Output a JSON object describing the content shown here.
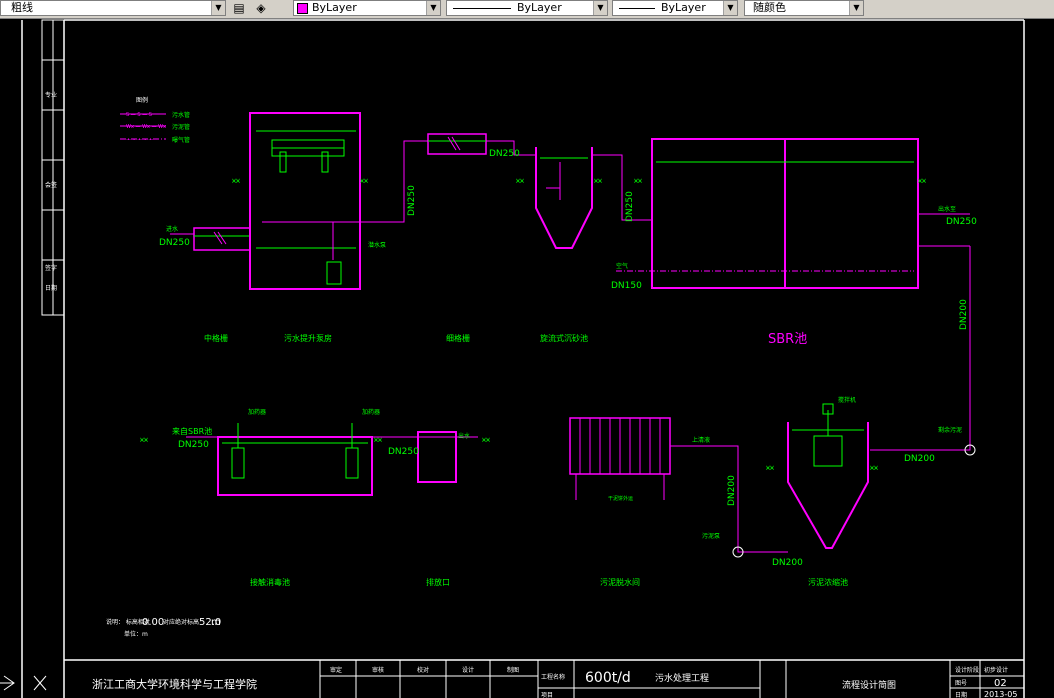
{
  "toolbar": {
    "linetype_name": "粗线",
    "color": "ByLayer",
    "linetype": "ByLayer",
    "lineweight": "ByLayer",
    "plot_style": "随颜色"
  },
  "legend": {
    "title": "图例",
    "items": [
      {
        "label": "污水管",
        "pattern": "S — S — S"
      },
      {
        "label": "污泥管",
        "pattern": "Wx — Wx — Wx"
      },
      {
        "label": "曝气管",
        "pattern": "— • — • —"
      }
    ]
  },
  "top_labels": {
    "grille_coarse": "中格栅",
    "pump_house": "污水提升泵房",
    "grille_fine": "细格栅",
    "grit_chamber": "旋流式沉砂池",
    "sbr": "SBR池"
  },
  "bottom_labels": {
    "contact_tank": "接触消毒池",
    "outfall": "排放口",
    "dewatering": "污泥脱水间",
    "sludge_thickener": "污泥浓缩池"
  },
  "pipe_labels": {
    "inlet": "进水",
    "dn250": "DN250",
    "dn150": "DN150",
    "dn200": "DN200",
    "air": "空气",
    "sbr_out": "出水至",
    "from_sbr": "来自SBR池",
    "outlet": "出水",
    "pump": "潜水泵",
    "sludge_pump": "污泥泵",
    "supernatant": "上清液",
    "dosing": "加药器",
    "mixer": "搅拌机",
    "remaining_sludge": "剩余污泥",
    "mud_cake": "干泥饼外运"
  },
  "notes": {
    "line1_prefix": "说明：  标高相对",
    "line1_value": "0.00",
    "line1_mid": "对应绝对标高",
    "line1_elev": "52.0",
    "line1_unit": "m",
    "line2": "单位：m"
  },
  "title_block": {
    "school": "浙江工商大学环境科学与工程学院",
    "headers": [
      "审定",
      "审核",
      "校对",
      "设计",
      "制图"
    ],
    "project_label": "工程名称",
    "project_name_value": "600t/d",
    "project_name_text": "污水处理工程",
    "subitem_label": "项目",
    "drawing_title": "流程设计简图",
    "design_stage_label": "设计阶段",
    "design_stage_value": "初步设计",
    "drawing_no_label": "图号",
    "drawing_no_value": "02",
    "date_label": "日期",
    "date_value": "2013-05"
  },
  "side_stamp": [
    "专业",
    "会签",
    "签字",
    "日期"
  ],
  "colors": {
    "magenta": "#ff00ff",
    "green": "#00ff00",
    "white": "#ffffff",
    "background": "#000000"
  }
}
